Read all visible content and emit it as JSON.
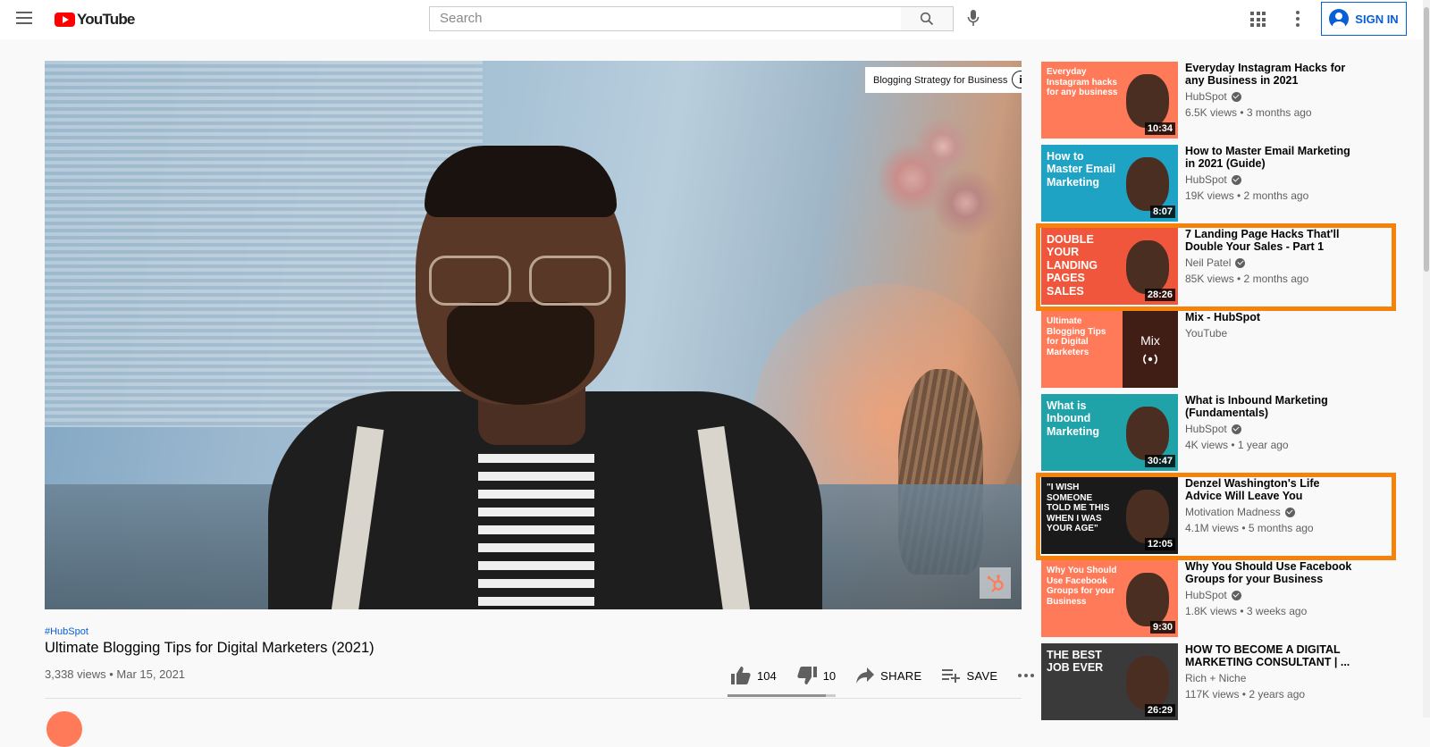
{
  "header": {
    "logo_text": "YouTube",
    "search_placeholder": "Search",
    "sign_in_label": "SIGN IN"
  },
  "player": {
    "card_teaser": "Blogging Strategy for Business",
    "info_label": "i"
  },
  "video": {
    "hashtag": "#HubSpot",
    "title": "Ultimate Blogging Tips for Digital Marketers (2021)",
    "meta": "3,338 views • Mar 15, 2021",
    "likes": "104",
    "dislikes": "10",
    "share_label": "SHARE",
    "save_label": "SAVE",
    "like_ratio": 0.91
  },
  "recommendations": [
    {
      "title": "Everyday Instagram Hacks for any Business in 2021",
      "channel": "HubSpot",
      "verified": true,
      "stats": "6.5K views • 3 months ago",
      "duration": "10:34",
      "thumb_text": "Everyday Instagram hacks for any business",
      "thumb_color": "#ff7a59",
      "highlight": false
    },
    {
      "title": "How to Master Email Marketing in 2021 (Guide)",
      "channel": "HubSpot",
      "verified": true,
      "stats": "19K views • 2 months ago",
      "duration": "8:07",
      "thumb_text": "How to Master Email Marketing",
      "thumb_color": "#1fa3c4",
      "highlight": false
    },
    {
      "title": "7 Landing Page Hacks That'll Double Your Sales - Part 1",
      "channel": "Neil Patel",
      "verified": true,
      "stats": "85K views • 2 months ago",
      "duration": "28:26",
      "thumb_text": "DOUBLE YOUR LANDING PAGES SALES",
      "thumb_color": "#f0563c",
      "highlight": true
    },
    {
      "title": "Mix - HubSpot",
      "channel": "YouTube",
      "verified": false,
      "stats": "",
      "duration": "",
      "thumb_text": "Ultimate Blogging Tips for Digital Marketers",
      "thumb_color": "#ff7a59",
      "highlight": false,
      "mix_label": "Mix"
    },
    {
      "title": "What is Inbound Marketing (Fundamentals)",
      "channel": "HubSpot",
      "verified": true,
      "stats": "4K views • 1 year ago",
      "duration": "30:47",
      "thumb_text": "What is Inbound Marketing",
      "thumb_color": "#1fa3a8",
      "highlight": false
    },
    {
      "title": "Denzel Washington's Life Advice Will Leave You Speechless...",
      "channel": "Motivation Madness",
      "verified": true,
      "stats": "4.1M views • 5 months ago",
      "duration": "12:05",
      "thumb_text": "\"I WISH SOMEONE TOLD ME THIS WHEN I WAS YOUR AGE\"",
      "thumb_color": "#1a1a1a",
      "highlight": true
    },
    {
      "title": "Why You Should Use Facebook Groups for your Business",
      "channel": "HubSpot",
      "verified": true,
      "stats": "1.8K views • 3 weeks ago",
      "duration": "9:30",
      "thumb_text": "Why You Should Use Facebook Groups for your Business",
      "thumb_color": "#ff7a59",
      "highlight": false
    },
    {
      "title": "HOW TO BECOME A DIGITAL MARKETING CONSULTANT | ...",
      "channel": "Rich + Niche",
      "verified": false,
      "stats": "117K views • 2 years ago",
      "duration": "26:29",
      "thumb_text": "THE BEST JOB EVER",
      "thumb_color": "#3a3a3a",
      "highlight": false
    }
  ],
  "colors": {
    "brand_red": "#ff0000",
    "link_blue": "#065fd4",
    "highlight_orange": "#f5820b",
    "hubspot_orange": "#ff7a59"
  },
  "icons": [
    "menu-icon",
    "youtube-logo-icon",
    "search-icon",
    "microphone-icon",
    "apps-grid-icon",
    "more-vert-icon",
    "account-icon",
    "info-icon",
    "hubspot-watermark-icon",
    "thumbs-up-icon",
    "thumbs-down-icon",
    "share-icon",
    "playlist-add-icon",
    "more-horiz-icon",
    "verified-icon",
    "mix-radio-icon"
  ]
}
